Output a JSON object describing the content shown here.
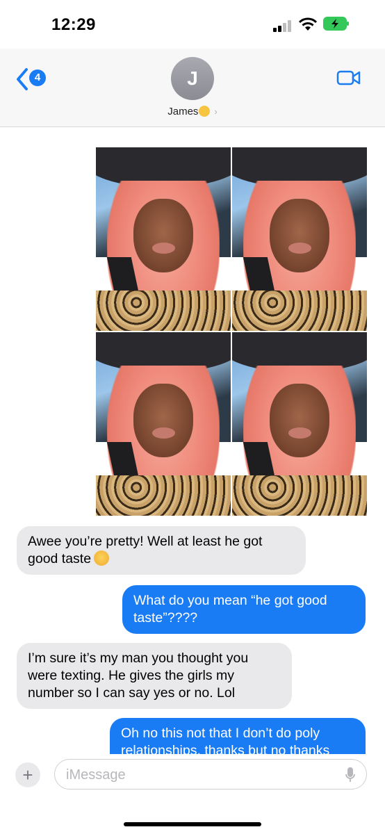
{
  "status_bar": {
    "time": "12:29"
  },
  "header": {
    "back_count": "4",
    "avatar_initial": "J",
    "contact_name": "James"
  },
  "messages": [
    {
      "direction": "received",
      "text": "Awee you’re pretty! Well at least he got good taste",
      "emoji": "hugging-face"
    },
    {
      "direction": "sent",
      "text": "What do you mean “he got good taste”????"
    },
    {
      "direction": "received",
      "text": "I’m sure it’s my man you thought you were texting. He gives the girls my number so I can say yes or no. Lol"
    },
    {
      "direction": "sent",
      "text": "Oh no this not that I don’t do poly relationships, thanks but no thanks"
    }
  ],
  "composer": {
    "placeholder": "iMessage"
  },
  "colors": {
    "sent_bubble": "#1a7cf5",
    "received_bubble": "#e9e9eb",
    "accent": "#1a7cf5",
    "battery": "#34c759"
  }
}
